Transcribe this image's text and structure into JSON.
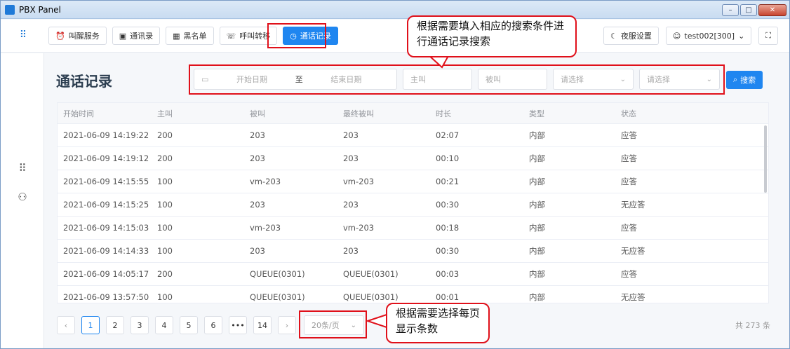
{
  "window": {
    "title": "PBX Panel",
    "min": "–",
    "max": "□",
    "close": "✕"
  },
  "nav": [
    {
      "label": "叫醒服务",
      "icon": "⏰"
    },
    {
      "label": "通讯录",
      "icon": "▣"
    },
    {
      "label": "黑名单",
      "icon": "▦"
    },
    {
      "label": "呼叫转移",
      "icon": "☏"
    },
    {
      "label": "通话记录",
      "icon": "◷"
    }
  ],
  "topright": {
    "night_label": "夜服设置",
    "user_label": "test002[300]",
    "user_chevron": "⌄",
    "fullscreen_icon": "⛶"
  },
  "page": {
    "title": "通话记录"
  },
  "filters": {
    "start_placeholder": "开始日期",
    "range_sep": "至",
    "end_placeholder": "结束日期",
    "caller_placeholder": "主叫",
    "callee_placeholder": "被叫",
    "select1_placeholder": "请选择",
    "select2_placeholder": "请选择",
    "search_label": "搜索"
  },
  "table": {
    "columns": [
      "开始时间",
      "主叫",
      "被叫",
      "最终被叫",
      "时长",
      "类型",
      "状态"
    ],
    "rows": [
      [
        "2021-06-09 14:19:22",
        "200",
        "203",
        "203",
        "02:07",
        "内部",
        "应答"
      ],
      [
        "2021-06-09 14:19:12",
        "200",
        "203",
        "203",
        "00:10",
        "内部",
        "应答"
      ],
      [
        "2021-06-09 14:15:55",
        "100",
        "vm-203",
        "vm-203",
        "00:21",
        "内部",
        "应答"
      ],
      [
        "2021-06-09 14:15:25",
        "100",
        "203",
        "203",
        "00:30",
        "内部",
        "无应答"
      ],
      [
        "2021-06-09 14:15:03",
        "100",
        "vm-203",
        "vm-203",
        "00:18",
        "内部",
        "应答"
      ],
      [
        "2021-06-09 14:14:33",
        "100",
        "203",
        "203",
        "00:30",
        "内部",
        "无应答"
      ],
      [
        "2021-06-09 14:05:17",
        "200",
        "QUEUE(0301)",
        "QUEUE(0301)",
        "00:03",
        "内部",
        "应答"
      ],
      [
        "2021-06-09 13:57:50",
        "100",
        "QUEUE(0301)",
        "QUEUE(0301)",
        "00:01",
        "内部",
        "无应答"
      ]
    ]
  },
  "pager": {
    "prev": "‹",
    "pages": [
      "1",
      "2",
      "3",
      "4",
      "5",
      "6",
      "•••",
      "14"
    ],
    "next": "›",
    "page_size": "20条/页",
    "total": "共 273 条"
  },
  "callouts": {
    "search_hint": "根据需要填入相应的搜索条件进行通话记录搜索",
    "pagesize_hint": "根据需要选择每页显示条数"
  },
  "colors": {
    "accent": "#1f86f0",
    "annotation": "#e0101a"
  }
}
